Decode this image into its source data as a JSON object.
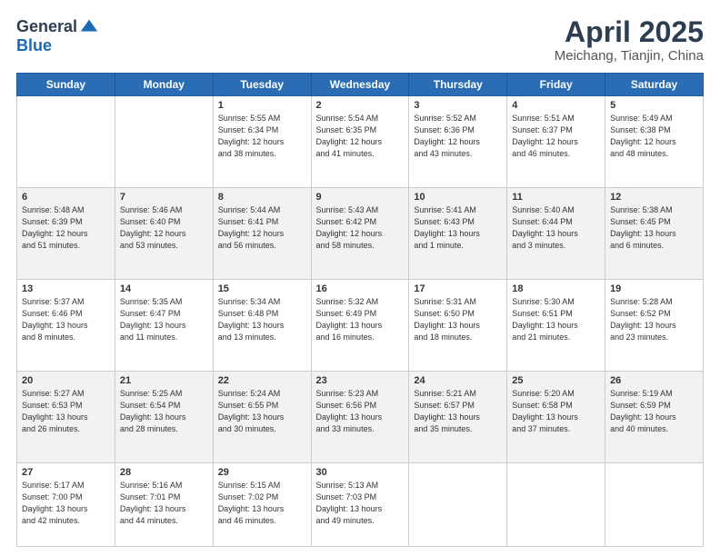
{
  "header": {
    "logo_general": "General",
    "logo_blue": "Blue",
    "title": "April 2025",
    "location": "Meichang, Tianjin, China"
  },
  "days_of_week": [
    "Sunday",
    "Monday",
    "Tuesday",
    "Wednesday",
    "Thursday",
    "Friday",
    "Saturday"
  ],
  "weeks": [
    [
      {
        "day": "",
        "info": ""
      },
      {
        "day": "",
        "info": ""
      },
      {
        "day": "1",
        "info": "Sunrise: 5:55 AM\nSunset: 6:34 PM\nDaylight: 12 hours\nand 38 minutes."
      },
      {
        "day": "2",
        "info": "Sunrise: 5:54 AM\nSunset: 6:35 PM\nDaylight: 12 hours\nand 41 minutes."
      },
      {
        "day": "3",
        "info": "Sunrise: 5:52 AM\nSunset: 6:36 PM\nDaylight: 12 hours\nand 43 minutes."
      },
      {
        "day": "4",
        "info": "Sunrise: 5:51 AM\nSunset: 6:37 PM\nDaylight: 12 hours\nand 46 minutes."
      },
      {
        "day": "5",
        "info": "Sunrise: 5:49 AM\nSunset: 6:38 PM\nDaylight: 12 hours\nand 48 minutes."
      }
    ],
    [
      {
        "day": "6",
        "info": "Sunrise: 5:48 AM\nSunset: 6:39 PM\nDaylight: 12 hours\nand 51 minutes."
      },
      {
        "day": "7",
        "info": "Sunrise: 5:46 AM\nSunset: 6:40 PM\nDaylight: 12 hours\nand 53 minutes."
      },
      {
        "day": "8",
        "info": "Sunrise: 5:44 AM\nSunset: 6:41 PM\nDaylight: 12 hours\nand 56 minutes."
      },
      {
        "day": "9",
        "info": "Sunrise: 5:43 AM\nSunset: 6:42 PM\nDaylight: 12 hours\nand 58 minutes."
      },
      {
        "day": "10",
        "info": "Sunrise: 5:41 AM\nSunset: 6:43 PM\nDaylight: 13 hours\nand 1 minute."
      },
      {
        "day": "11",
        "info": "Sunrise: 5:40 AM\nSunset: 6:44 PM\nDaylight: 13 hours\nand 3 minutes."
      },
      {
        "day": "12",
        "info": "Sunrise: 5:38 AM\nSunset: 6:45 PM\nDaylight: 13 hours\nand 6 minutes."
      }
    ],
    [
      {
        "day": "13",
        "info": "Sunrise: 5:37 AM\nSunset: 6:46 PM\nDaylight: 13 hours\nand 8 minutes."
      },
      {
        "day": "14",
        "info": "Sunrise: 5:35 AM\nSunset: 6:47 PM\nDaylight: 13 hours\nand 11 minutes."
      },
      {
        "day": "15",
        "info": "Sunrise: 5:34 AM\nSunset: 6:48 PM\nDaylight: 13 hours\nand 13 minutes."
      },
      {
        "day": "16",
        "info": "Sunrise: 5:32 AM\nSunset: 6:49 PM\nDaylight: 13 hours\nand 16 minutes."
      },
      {
        "day": "17",
        "info": "Sunrise: 5:31 AM\nSunset: 6:50 PM\nDaylight: 13 hours\nand 18 minutes."
      },
      {
        "day": "18",
        "info": "Sunrise: 5:30 AM\nSunset: 6:51 PM\nDaylight: 13 hours\nand 21 minutes."
      },
      {
        "day": "19",
        "info": "Sunrise: 5:28 AM\nSunset: 6:52 PM\nDaylight: 13 hours\nand 23 minutes."
      }
    ],
    [
      {
        "day": "20",
        "info": "Sunrise: 5:27 AM\nSunset: 6:53 PM\nDaylight: 13 hours\nand 26 minutes."
      },
      {
        "day": "21",
        "info": "Sunrise: 5:25 AM\nSunset: 6:54 PM\nDaylight: 13 hours\nand 28 minutes."
      },
      {
        "day": "22",
        "info": "Sunrise: 5:24 AM\nSunset: 6:55 PM\nDaylight: 13 hours\nand 30 minutes."
      },
      {
        "day": "23",
        "info": "Sunrise: 5:23 AM\nSunset: 6:56 PM\nDaylight: 13 hours\nand 33 minutes."
      },
      {
        "day": "24",
        "info": "Sunrise: 5:21 AM\nSunset: 6:57 PM\nDaylight: 13 hours\nand 35 minutes."
      },
      {
        "day": "25",
        "info": "Sunrise: 5:20 AM\nSunset: 6:58 PM\nDaylight: 13 hours\nand 37 minutes."
      },
      {
        "day": "26",
        "info": "Sunrise: 5:19 AM\nSunset: 6:59 PM\nDaylight: 13 hours\nand 40 minutes."
      }
    ],
    [
      {
        "day": "27",
        "info": "Sunrise: 5:17 AM\nSunset: 7:00 PM\nDaylight: 13 hours\nand 42 minutes."
      },
      {
        "day": "28",
        "info": "Sunrise: 5:16 AM\nSunset: 7:01 PM\nDaylight: 13 hours\nand 44 minutes."
      },
      {
        "day": "29",
        "info": "Sunrise: 5:15 AM\nSunset: 7:02 PM\nDaylight: 13 hours\nand 46 minutes."
      },
      {
        "day": "30",
        "info": "Sunrise: 5:13 AM\nSunset: 7:03 PM\nDaylight: 13 hours\nand 49 minutes."
      },
      {
        "day": "",
        "info": ""
      },
      {
        "day": "",
        "info": ""
      },
      {
        "day": "",
        "info": ""
      }
    ]
  ]
}
